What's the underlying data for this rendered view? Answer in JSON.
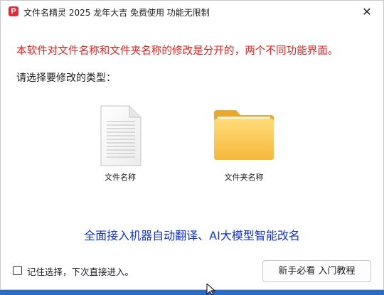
{
  "window": {
    "title": "文件名精灵 2025 龙年大吉 免费使用 功能无限制",
    "close_glyph": "✕"
  },
  "notice": "本软件对文件名称和文件夹名称的修改是分开的，两个不同功能界面。",
  "prompt": "请选择要修改的类型：",
  "options": [
    {
      "label": "文件名称",
      "icon": "file-icon"
    },
    {
      "label": "文件夹名称",
      "icon": "folder-icon"
    }
  ],
  "promo": "全面接入机器自动翻译、AI大模型智能改名",
  "remember": {
    "label": "记住选择，下次直接进入。",
    "checked": false
  },
  "tutorial_button": "新手必看 入门教程",
  "colors": {
    "notice": "#e8201c",
    "promo": "#1133dd",
    "folder": "#fcc74c",
    "app_icon": "#e02a38"
  }
}
